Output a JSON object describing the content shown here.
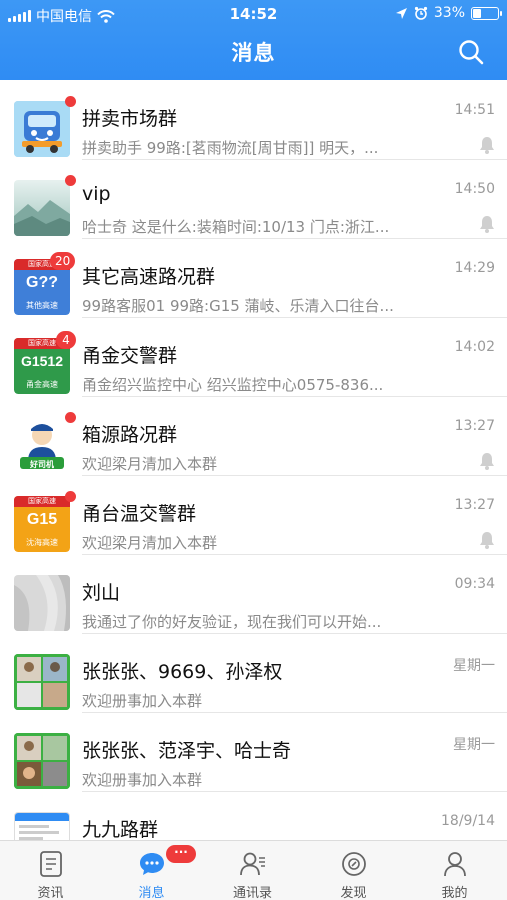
{
  "status_bar": {
    "carrier": "中国电信",
    "time": "14:52",
    "battery": "33%",
    "battery_level": 0.33
  },
  "nav": {
    "title": "消息",
    "search_icon": "search-icon"
  },
  "conversations": [
    {
      "name": "拼卖市场群",
      "preview": "拼卖助手 99路:[茗雨物流[周甘雨]] 明天，...",
      "time": "14:51",
      "unread_dot": true,
      "muted": true
    },
    {
      "name": "vip",
      "preview": "哈士奇 这是什么:装箱时间:10/13 门点:浙江...",
      "time": "14:50",
      "unread_dot": true,
      "muted": true
    },
    {
      "name": "其它高速路况群",
      "preview": "99路客服01 99路:G15 蒲岐、乐清入口往台...",
      "time": "14:29",
      "unread_count": "20",
      "muted": false,
      "avatar": {
        "top": "国家高速",
        "code": "G??",
        "sub": "其他高速",
        "color": "#3f7fd8"
      }
    },
    {
      "name": "甬金交警群",
      "preview": "甬金绍兴监控中心 绍兴监控中心0575-836...",
      "time": "14:02",
      "unread_count": "4",
      "muted": false,
      "avatar": {
        "top": "国家高速",
        "code": "G1512",
        "sub": "甬金高速",
        "color": "#2f9a4a"
      }
    },
    {
      "name": "箱源路况群",
      "preview": "欢迎梁月清加入本群",
      "time": "13:27",
      "unread_dot": true,
      "muted": true,
      "avatar": {
        "logo_text": "好司机"
      }
    },
    {
      "name": "甬台温交警群",
      "preview": "欢迎梁月清加入本群",
      "time": "13:27",
      "unread_dot": true,
      "muted": true,
      "avatar": {
        "top": "国家高速",
        "code": "G15",
        "sub": "沈海高速",
        "color": "#f3a316"
      }
    },
    {
      "name": "刘山",
      "preview": "我通过了你的好友验证，现在我们可以开始...",
      "time": "09:34",
      "muted": false
    },
    {
      "name": "张张张、9669、孙泽权",
      "preview": "欢迎册事加入本群",
      "time": "星期一",
      "muted": false
    },
    {
      "name": "张张张、范泽宇、哈士奇",
      "preview": "欢迎册事加入本群",
      "time": "星期一",
      "muted": false
    },
    {
      "name": "九九路群",
      "preview": "",
      "time": "18/9/14",
      "muted": false
    }
  ],
  "tabbar": {
    "tabs": [
      {
        "label": "资讯",
        "icon": "news-icon"
      },
      {
        "label": "消息",
        "icon": "chat-icon",
        "active": true,
        "badge": "···"
      },
      {
        "label": "通讯录",
        "icon": "contacts-icon"
      },
      {
        "label": "发现",
        "icon": "compass-icon"
      },
      {
        "label": "我的",
        "icon": "profile-icon"
      }
    ]
  },
  "colors": {
    "header_blue": "#2f8cf3",
    "badge_red": "#ee3b3b",
    "active_tab": "#2f8cf3"
  }
}
